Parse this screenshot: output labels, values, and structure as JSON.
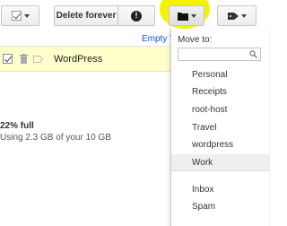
{
  "toolbar": {
    "delete_forever_label": "Delete forever",
    "spam_symbol": "!"
  },
  "main": {
    "empty_trash_link": "Empty T",
    "rows": [
      {
        "sender": "WordPress"
      }
    ],
    "quota": {
      "percent_full": "22% full",
      "usage_text": "Using 2.3 GB of your 10 GB"
    }
  },
  "move_menu": {
    "title": "Move to:",
    "search_value": "",
    "labels": [
      "Personal",
      "Receipts",
      "root-host",
      "Travel",
      "wordpress",
      "Work"
    ],
    "system": [
      "Inbox",
      "Spam"
    ],
    "highlighted": "Work"
  },
  "colors": {
    "highlight": "#f4f300",
    "selected_row": "#ffffcc",
    "link": "#1a55cc"
  }
}
